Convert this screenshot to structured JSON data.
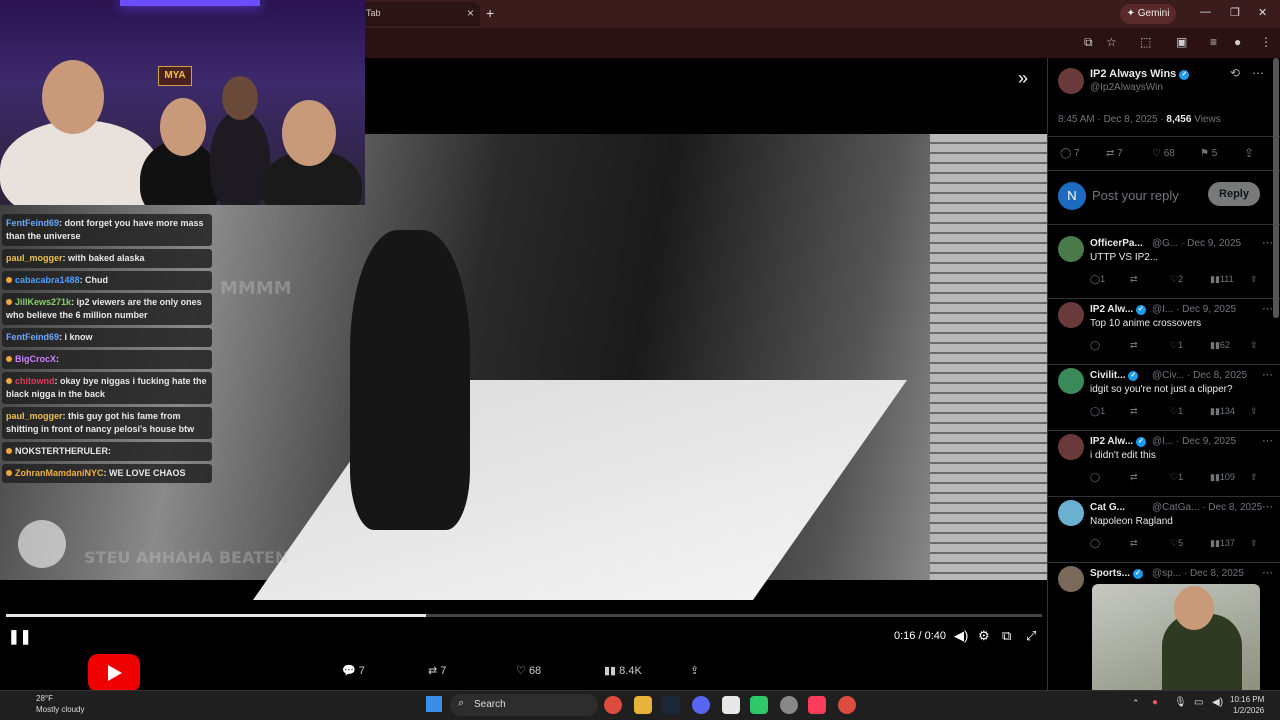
{
  "browser": {
    "tab_title": "Tab",
    "new_tab_icon": "+",
    "gemini_label": "Gemini"
  },
  "stream": {
    "sign_text": "MYA",
    "chat": [
      {
        "user": "FentFeind69",
        "user_color": "#6aa8ff",
        "text": ": dont forget you have more mass than the universe",
        "badge": false
      },
      {
        "user": "paul_mogger",
        "user_color": "#f0c050",
        "text": ": with baked alaska",
        "badge": false
      },
      {
        "user": "cabacabra1488",
        "user_color": "#4aa0ff",
        "text": ": Chud",
        "badge": true
      },
      {
        "user": "JillKews271k",
        "user_color": "#8ad06a",
        "text": ": ip2 viewers are the only ones who believe the 6 million number",
        "badge": true
      },
      {
        "user": "FentFeind69",
        "user_color": "#6aa8ff",
        "text": ": i know",
        "badge": false
      },
      {
        "user": "BigCrocX",
        "user_color": "#d080ff",
        "text": ":",
        "badge": true
      },
      {
        "user": "chitownd",
        "user_color": "#e03c5a",
        "text": ": okay bye niggas i fucking hate the black nigga in the back",
        "badge": true
      },
      {
        "user": "paul_mogger",
        "user_color": "#f0c050",
        "text": ": this guy got his fame from shitting in front of nancy pelosi's house btw",
        "badge": false
      },
      {
        "user": "NOKSTERTHERULER",
        "user_color": "#e8e8e8",
        "text": ":",
        "badge": true
      },
      {
        "user": "ZohranMamdaniNYC",
        "user_color": "#f0b040",
        "text": ": WE LOVE CHAOS",
        "badge": true
      }
    ]
  },
  "video": {
    "overlay_text_1": "MMMM",
    "overlay_text_2": "STEU AHHAHA BEATEN",
    "time": "0:16 / 0:40",
    "progress": 0.405,
    "actions": {
      "replies": "7",
      "reposts": "7",
      "likes": "68",
      "views": "8.4K"
    }
  },
  "post": {
    "author_name": "IP2 Always Wins",
    "author_handle": "@Ip2AlwaysWin",
    "timestamp": "8:45 AM · Dec 8, 2025 ·",
    "views_count": "8,456",
    "views_label": "Views",
    "stats": {
      "replies": "7",
      "reposts": "7",
      "likes": "68",
      "bookmarks": "5"
    },
    "reply_placeholder": "Post your reply",
    "reply_button": "Reply",
    "composer_initial": "N"
  },
  "replies": [
    {
      "name": "OfficerPa...",
      "handle": "@G...",
      "date": "· Dec 9, 2025",
      "text": "UTTP VS IP2...",
      "replies": "1",
      "reposts": "",
      "likes": "2",
      "views": "111",
      "avatar_color": "#4a7a4a"
    },
    {
      "name": "IP2 Alw...",
      "handle": "@I...",
      "date": "· Dec 9, 2025",
      "text": "Top 10 anime crossovers",
      "replies": "",
      "reposts": "",
      "likes": "1",
      "views": "62",
      "avatar_color": "#6a3a3a",
      "verified": true
    },
    {
      "name": "Civilit...",
      "handle": "@Civ...",
      "date": "· Dec 8, 2025",
      "text": "idgit so you're not just a clipper?",
      "replies": "1",
      "reposts": "",
      "likes": "1",
      "views": "134",
      "avatar_color": "#3a8a5a",
      "verified": true
    },
    {
      "name": "IP2 Alw...",
      "handle": "@I...",
      "date": "· Dec 9, 2025",
      "text": "i didn't edit this",
      "replies": "",
      "reposts": "",
      "likes": "1",
      "views": "109",
      "avatar_color": "#6a3a3a",
      "verified": true
    },
    {
      "name": "Cat G...",
      "handle": "@CatGa...",
      "date": "· Dec 8, 2025",
      "text": "Napoleon Ragland",
      "replies": "",
      "reposts": "",
      "likes": "5",
      "views": "137",
      "avatar_color": "#6ab0d0"
    },
    {
      "name": "Sports...",
      "handle": "@sp...",
      "date": "· Dec 8, 2025",
      "text": "",
      "replies": "",
      "reposts": "",
      "likes": "",
      "views": "",
      "avatar_color": "#7a6a5a",
      "verified": true
    }
  ],
  "taskbar": {
    "temperature": "28°F",
    "weather": "Mostly cloudy",
    "search_placeholder": "Search",
    "time": "10:16 PM",
    "date": "1/2/2026"
  }
}
